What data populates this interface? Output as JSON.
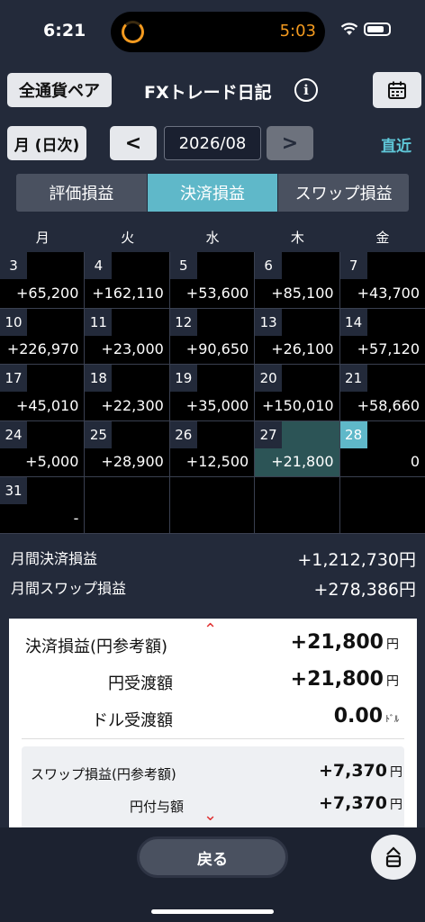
{
  "status_bar": {
    "time": "6:21",
    "timer": "5:03"
  },
  "header": {
    "all_pairs_label": "全通貨ペア",
    "title": "FXトレード日記",
    "info_icon": "info-icon",
    "calendar_icon": "calendar-icon"
  },
  "nav": {
    "mode_label": "月 (日次)",
    "prev_label": "<",
    "date": "2026/08",
    "next_label": ">",
    "recent_label": "直近"
  },
  "tabs": [
    {
      "label": "評価損益",
      "active": false
    },
    {
      "label": "決済損益",
      "active": true
    },
    {
      "label": "スワップ損益",
      "active": false
    }
  ],
  "weekdays": [
    "月",
    "火",
    "水",
    "木",
    "金"
  ],
  "calendar": [
    {
      "day": "3",
      "amount": "+65,200"
    },
    {
      "day": "4",
      "amount": "+162,110"
    },
    {
      "day": "5",
      "amount": "+53,600"
    },
    {
      "day": "6",
      "amount": "+85,100"
    },
    {
      "day": "7",
      "amount": "+43,700"
    },
    {
      "day": "10",
      "amount": "+226,970"
    },
    {
      "day": "11",
      "amount": "+23,000"
    },
    {
      "day": "12",
      "amount": "+90,650"
    },
    {
      "day": "13",
      "amount": "+26,100"
    },
    {
      "day": "14",
      "amount": "+57,120"
    },
    {
      "day": "17",
      "amount": "+45,010"
    },
    {
      "day": "18",
      "amount": "+22,300"
    },
    {
      "day": "19",
      "amount": "+35,000"
    },
    {
      "day": "20",
      "amount": "+150,010"
    },
    {
      "day": "21",
      "amount": "+58,660"
    },
    {
      "day": "24",
      "amount": "+5,000"
    },
    {
      "day": "25",
      "amount": "+28,900"
    },
    {
      "day": "26",
      "amount": "+12,500"
    },
    {
      "day": "27",
      "amount": "+21,800",
      "selected": true
    },
    {
      "day": "28",
      "amount": "0",
      "today": true
    },
    {
      "day": "31",
      "amount": "-"
    },
    {
      "day": "",
      "amount": ""
    },
    {
      "day": "",
      "amount": ""
    },
    {
      "day": "",
      "amount": ""
    },
    {
      "day": "",
      "amount": ""
    }
  ],
  "monthly": {
    "settled_label": "月間決済損益",
    "settled_value": "+1,212,730円",
    "swap_label": "月間スワップ損益",
    "swap_value": "+278,386円"
  },
  "detail": {
    "pl_label": "決済損益(円参考額)",
    "pl_value": "+21,800",
    "pl_unit": "円",
    "jpy_label": "円受渡額",
    "jpy_value": "+21,800",
    "jpy_unit": "円",
    "usd_label": "ドル受渡額",
    "usd_value": "0.00",
    "usd_unit": "ﾄﾞﾙ",
    "swap_label": "スワップ損益(円参考額)",
    "swap_value": "+7,370",
    "swap_unit": "円",
    "grant_label": "円付与額",
    "grant_value": "+7,370",
    "grant_unit": "円"
  },
  "bottom": {
    "back_label": "戻る",
    "round_icon": "menu-icon"
  }
}
